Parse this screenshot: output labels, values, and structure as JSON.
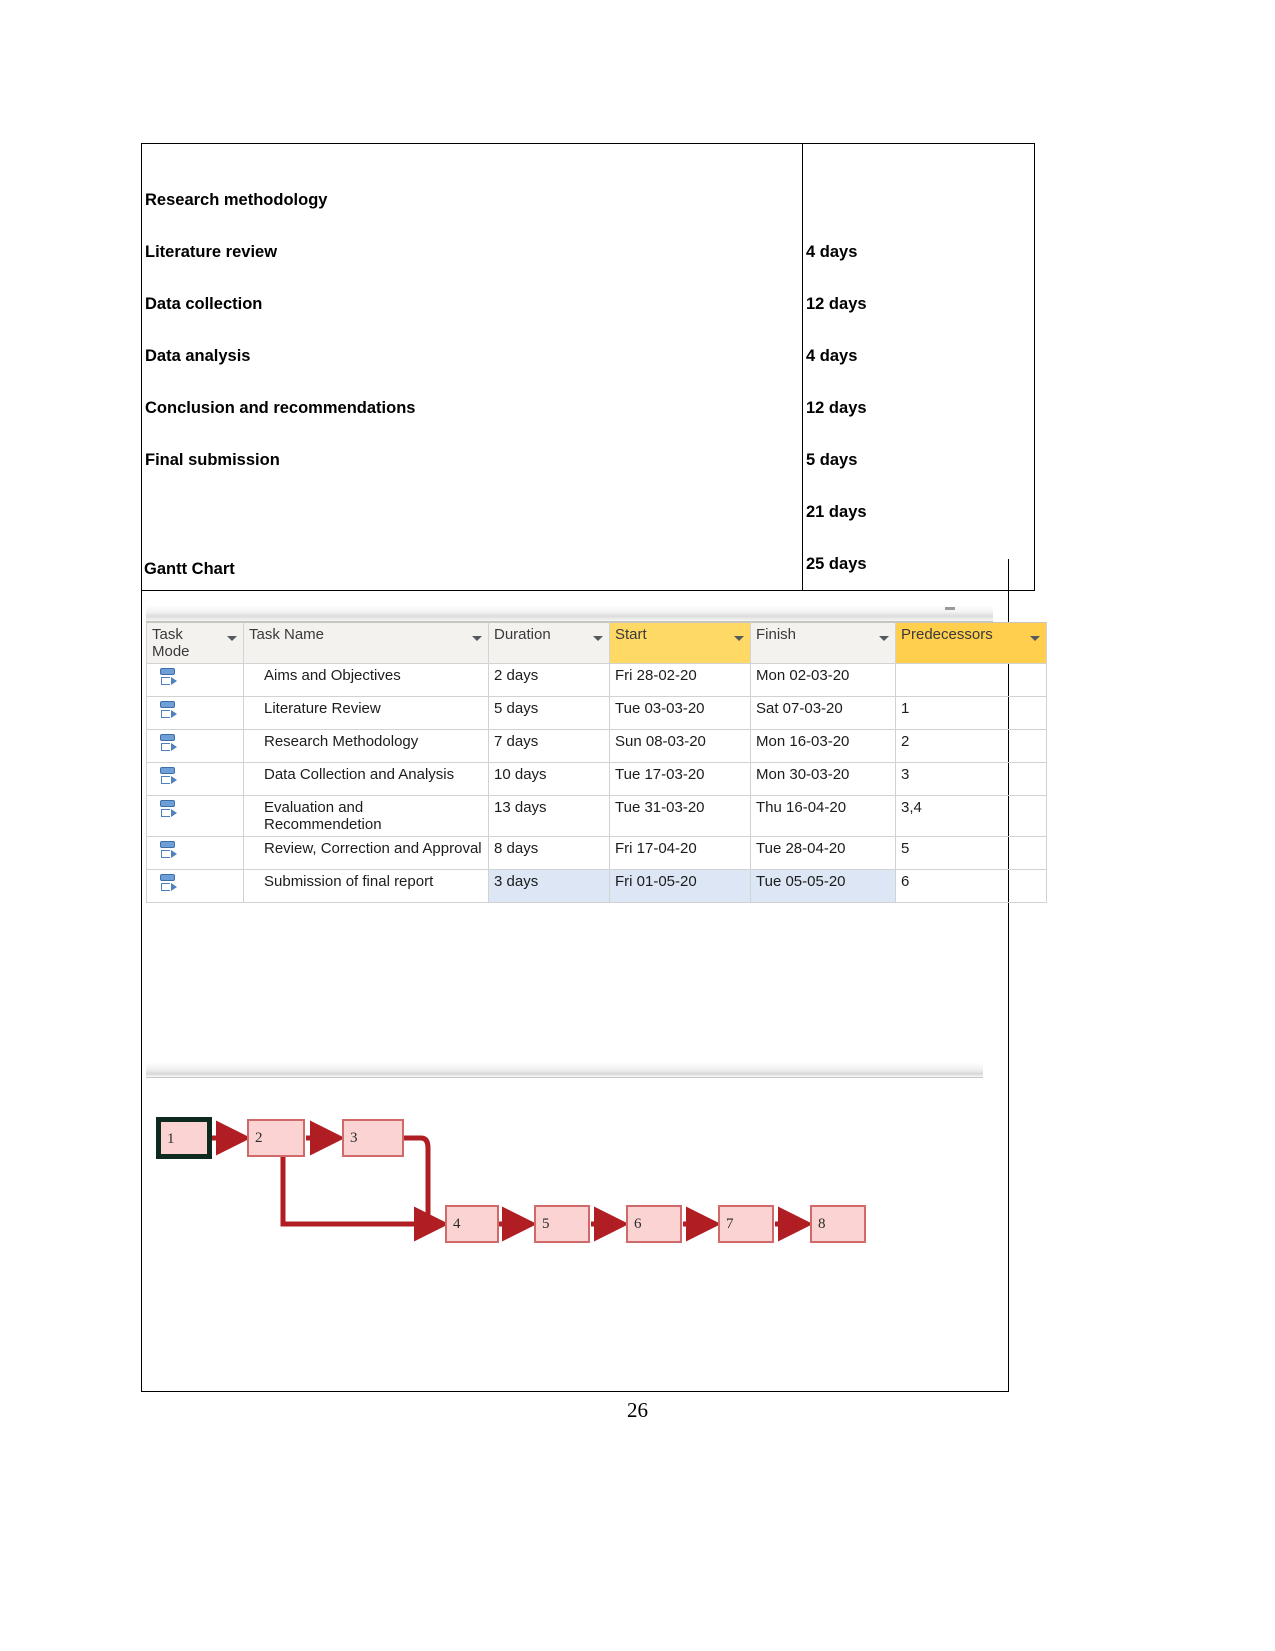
{
  "schedule_table": {
    "tasks": [
      "Research methodology",
      "Literature review",
      "Data collection",
      "Data analysis",
      "Conclusion and recommendations",
      "Final submission"
    ],
    "durations": [
      "4 days",
      "12 days",
      "4 days",
      "12 days",
      "5 days",
      "21 days",
      "25 days"
    ]
  },
  "gantt": {
    "caption": "Gantt Chart",
    "columns": [
      {
        "label": "Task Mode",
        "line1": "Task",
        "line2": "Mode",
        "highlight": "none"
      },
      {
        "label": "Task Name",
        "line1": "Task Name",
        "line2": "",
        "highlight": "none"
      },
      {
        "label": "Duration",
        "line1": "Duration",
        "line2": "",
        "highlight": "none"
      },
      {
        "label": "Start",
        "line1": "Start",
        "line2": "",
        "highlight": "yellow"
      },
      {
        "label": "Finish",
        "line1": "Finish",
        "line2": "",
        "highlight": "none"
      },
      {
        "label": "Predecessors",
        "line1": "Predecessors",
        "line2": "",
        "highlight": "yellow"
      }
    ],
    "rows": [
      {
        "mode_icon": "auto-schedule-icon",
        "name": "Aims and Objectives",
        "duration": "2 days",
        "start": "Fri 28-02-20",
        "finish": "Mon 02-03-20",
        "predecessors": ""
      },
      {
        "mode_icon": "auto-schedule-icon",
        "name": "Literature Review",
        "duration": "5 days",
        "start": "Tue 03-03-20",
        "finish": "Sat 07-03-20",
        "predecessors": "1"
      },
      {
        "mode_icon": "auto-schedule-icon",
        "name": "Research Methodology",
        "duration": "7 days",
        "start": "Sun 08-03-20",
        "finish": "Mon 16-03-20",
        "predecessors": "2"
      },
      {
        "mode_icon": "auto-schedule-icon",
        "name": "Data Collection and Analysis",
        "duration": "10 days",
        "start": "Tue 17-03-20",
        "finish": "Mon 30-03-20",
        "predecessors": "3"
      },
      {
        "mode_icon": "auto-schedule-icon",
        "name": "Evaluation and Recommendetion",
        "duration": "13 days",
        "start": "Tue 31-03-20",
        "finish": "Thu 16-04-20",
        "predecessors": "3,4"
      },
      {
        "mode_icon": "auto-schedule-icon",
        "name": "Review, Correction and Approval",
        "duration": "8 days",
        "start": "Fri 17-04-20",
        "finish": "Tue 28-04-20",
        "predecessors": "5"
      },
      {
        "mode_icon": "auto-schedule-icon",
        "name": "Submission of final report",
        "duration": "3 days",
        "start": "Fri 01-05-20",
        "finish": "Tue 05-05-20",
        "predecessors": "6",
        "selected": true
      }
    ]
  },
  "network_diagram": {
    "nodes": [
      {
        "id": "1",
        "label": "1",
        "selected": true
      },
      {
        "id": "2",
        "label": "2",
        "selected": false
      },
      {
        "id": "3",
        "label": "3",
        "selected": false
      },
      {
        "id": "4",
        "label": "4",
        "selected": false
      },
      {
        "id": "5",
        "label": "5",
        "selected": false
      },
      {
        "id": "6",
        "label": "6",
        "selected": false
      },
      {
        "id": "7",
        "label": "7",
        "selected": false
      },
      {
        "id": "8",
        "label": "8",
        "selected": false
      }
    ],
    "links": [
      "1-2",
      "2-3",
      "2-4",
      "3-4",
      "4-5",
      "5-6",
      "6-7",
      "7-8"
    ],
    "node_fill": "#fbd3d3",
    "node_border": "#d06a6a",
    "link_color": "#b01e24"
  },
  "footer": {
    "page_number": "26"
  }
}
